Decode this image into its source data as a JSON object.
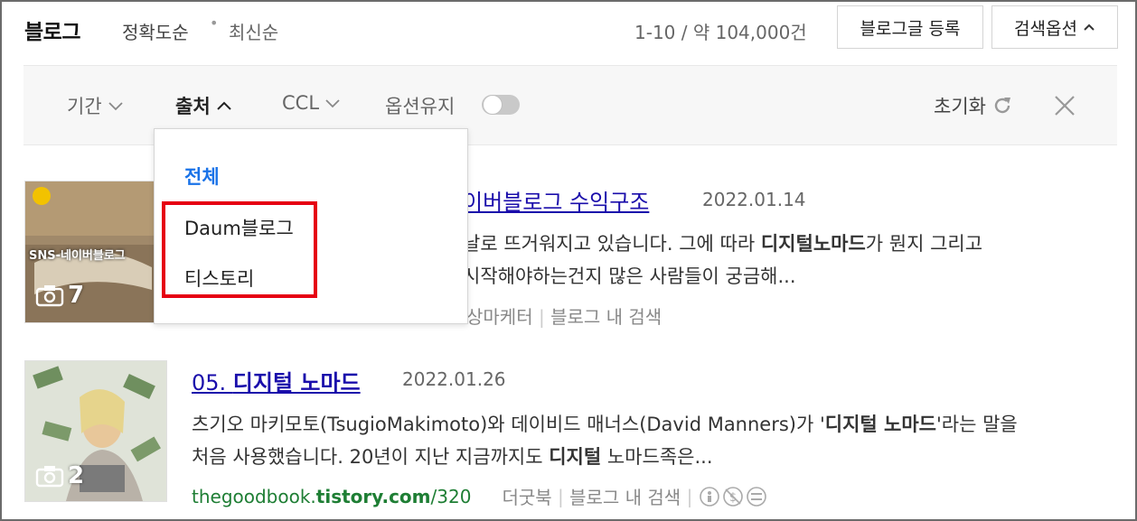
{
  "header": {
    "title": "블로그",
    "sort_accuracy": "정확도순",
    "sort_latest": "최신순",
    "count": "1-10 / 약 104,000건",
    "register_button": "블로그글 등록",
    "options_button": "검색옵션"
  },
  "filters": {
    "period": "기간",
    "source": "출처",
    "ccl": "CCL",
    "keep_options": "옵션유지",
    "reset": "초기화"
  },
  "source_dropdown": {
    "items": [
      "전체",
      "Daum블로그",
      "티스토리"
    ],
    "selected": "전체"
  },
  "results": [
    {
      "title_visible": "이버블로그 수익구조",
      "date": "2022.01.14",
      "desc_line1": "날로 뜨거워지고 있습니다. 그에 따라 ",
      "desc_bold1": "디지털노마드",
      "desc_line1_end": "가 뭔지 그리고",
      "desc_line2": "시작해야하는건지 많은 사람들이 궁금해...",
      "meta_author": "상마케터",
      "meta_search": "블로그 내 검색",
      "image_count": "7",
      "thumb_text": "SNS-네이버블로그"
    },
    {
      "title_prefix": "05. ",
      "title_bold": "디지털 노마드",
      "date": "2022.01.26",
      "desc_line1_a": "츠기오 마키모토(TsugioMakimoto)와 데이비드 매너스(David Manners)가 '",
      "desc_line1_b": "디지털 노마드",
      "desc_line1_c": "'라는 말을",
      "desc_line2_a": "처음 사용했습니다. 20년이 지난 지금까지도 ",
      "desc_line2_b": "디지털",
      "desc_line2_c": " 노마드족은...",
      "url_prefix": "thegoodbook.",
      "url_domain": "tistory.com",
      "url_suffix": "/320",
      "meta_author": "더굿북",
      "meta_search": "블로그 내 검색",
      "image_count": "2"
    }
  ],
  "colors": {
    "link": "#1a0dab",
    "dropdown_selected": "#1a73e8",
    "highlight_box": "#e60012",
    "url_green": "#1e7e34"
  }
}
